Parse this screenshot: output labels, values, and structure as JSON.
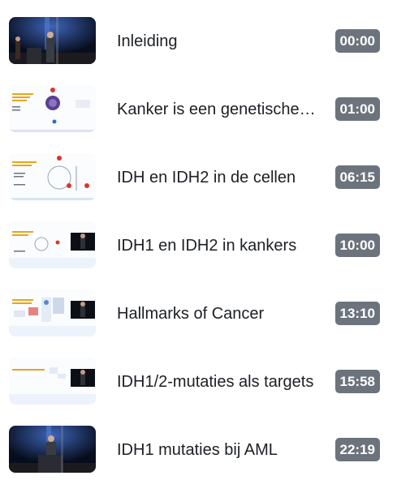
{
  "chapters": [
    {
      "title": "Inleiding",
      "time": "00:00",
      "thumb": "stage-two-speakers"
    },
    {
      "title": "Kanker is een genetische ziekte",
      "time": "01:00",
      "thumb": "slide-gene"
    },
    {
      "title": "IDH en IDH2 in de cellen",
      "time": "06:15",
      "thumb": "slide-cycle"
    },
    {
      "title": "IDH1 en IDH2 in kankers",
      "time": "10:00",
      "thumb": "slide-speaker-inset"
    },
    {
      "title": "Hallmarks of Cancer",
      "time": "13:10",
      "thumb": "slide-speaker-inset"
    },
    {
      "title": "IDH1/2-mutaties als targets",
      "time": "15:58",
      "thumb": "slide-speaker-inset"
    },
    {
      "title": "IDH1 mutaties bij AML",
      "time": "22:19",
      "thumb": "stage-podium"
    }
  ],
  "colors": {
    "badge_bg": "#6c737c",
    "title_text": "#1c1f24",
    "stage_bg": "#0b1326",
    "slide_accent": "#e8a41f"
  }
}
